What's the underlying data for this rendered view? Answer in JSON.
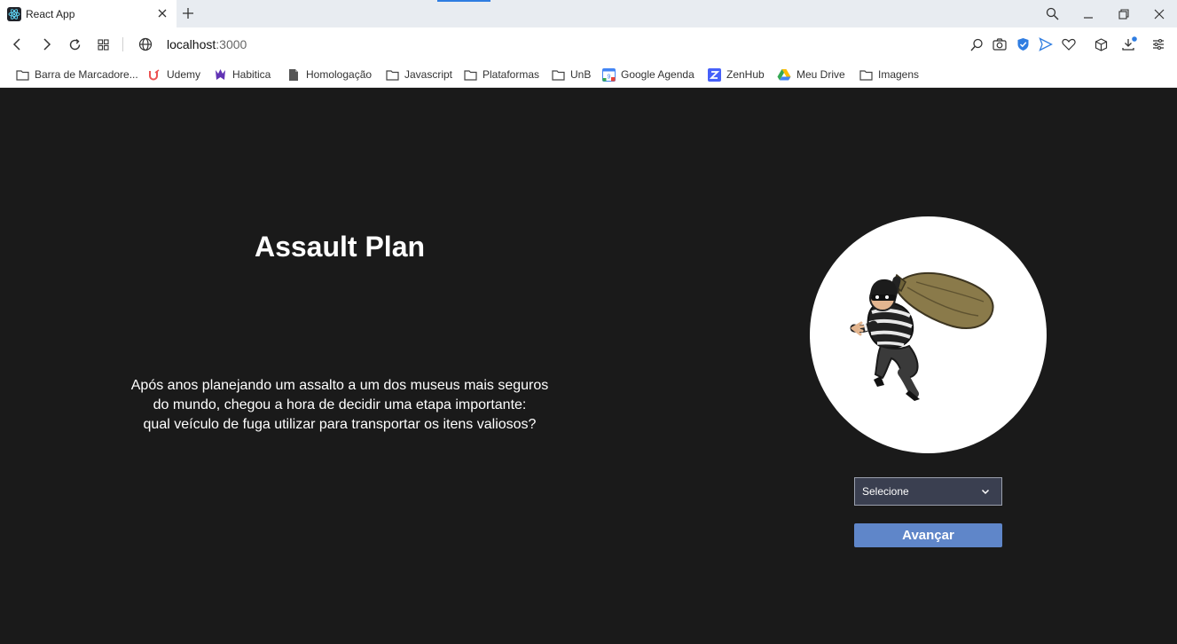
{
  "browser": {
    "tab_title": "React App",
    "url_host": "localhost",
    "url_port": ":3000"
  },
  "bookmarks": [
    {
      "label": "Barra de Marcadore...",
      "icon": "folder-icon"
    },
    {
      "label": "Udemy",
      "icon": "udemy-icon"
    },
    {
      "label": "Habitica",
      "icon": "habitica-icon"
    },
    {
      "label": "Homologação",
      "icon": "document-icon"
    },
    {
      "label": "Javascript",
      "icon": "folder-icon"
    },
    {
      "label": "Plataformas",
      "icon": "folder-icon"
    },
    {
      "label": "UnB",
      "icon": "folder-icon"
    },
    {
      "label": "Google Agenda",
      "icon": "google-calendar-icon"
    },
    {
      "label": "ZenHub",
      "icon": "zenhub-icon"
    },
    {
      "label": "Meu Drive",
      "icon": "google-drive-icon"
    },
    {
      "label": "Imagens",
      "icon": "folder-icon"
    }
  ],
  "main": {
    "title": "Assault Plan",
    "description_lines": [
      "Após anos planejando um assalto a um dos museus mais seguros",
      "do mundo, chegou a hora de decidir uma etapa importante:",
      "qual veículo de fuga utilizar para transportar os itens valiosos?"
    ],
    "image": "thief-with-loot-bag-illustration",
    "select_value": "Selecione",
    "advance_label": "Avançar"
  },
  "colors": {
    "page_background": "#1a1a1a",
    "button": "#5f86c9",
    "select_background": "#3a3f50"
  }
}
